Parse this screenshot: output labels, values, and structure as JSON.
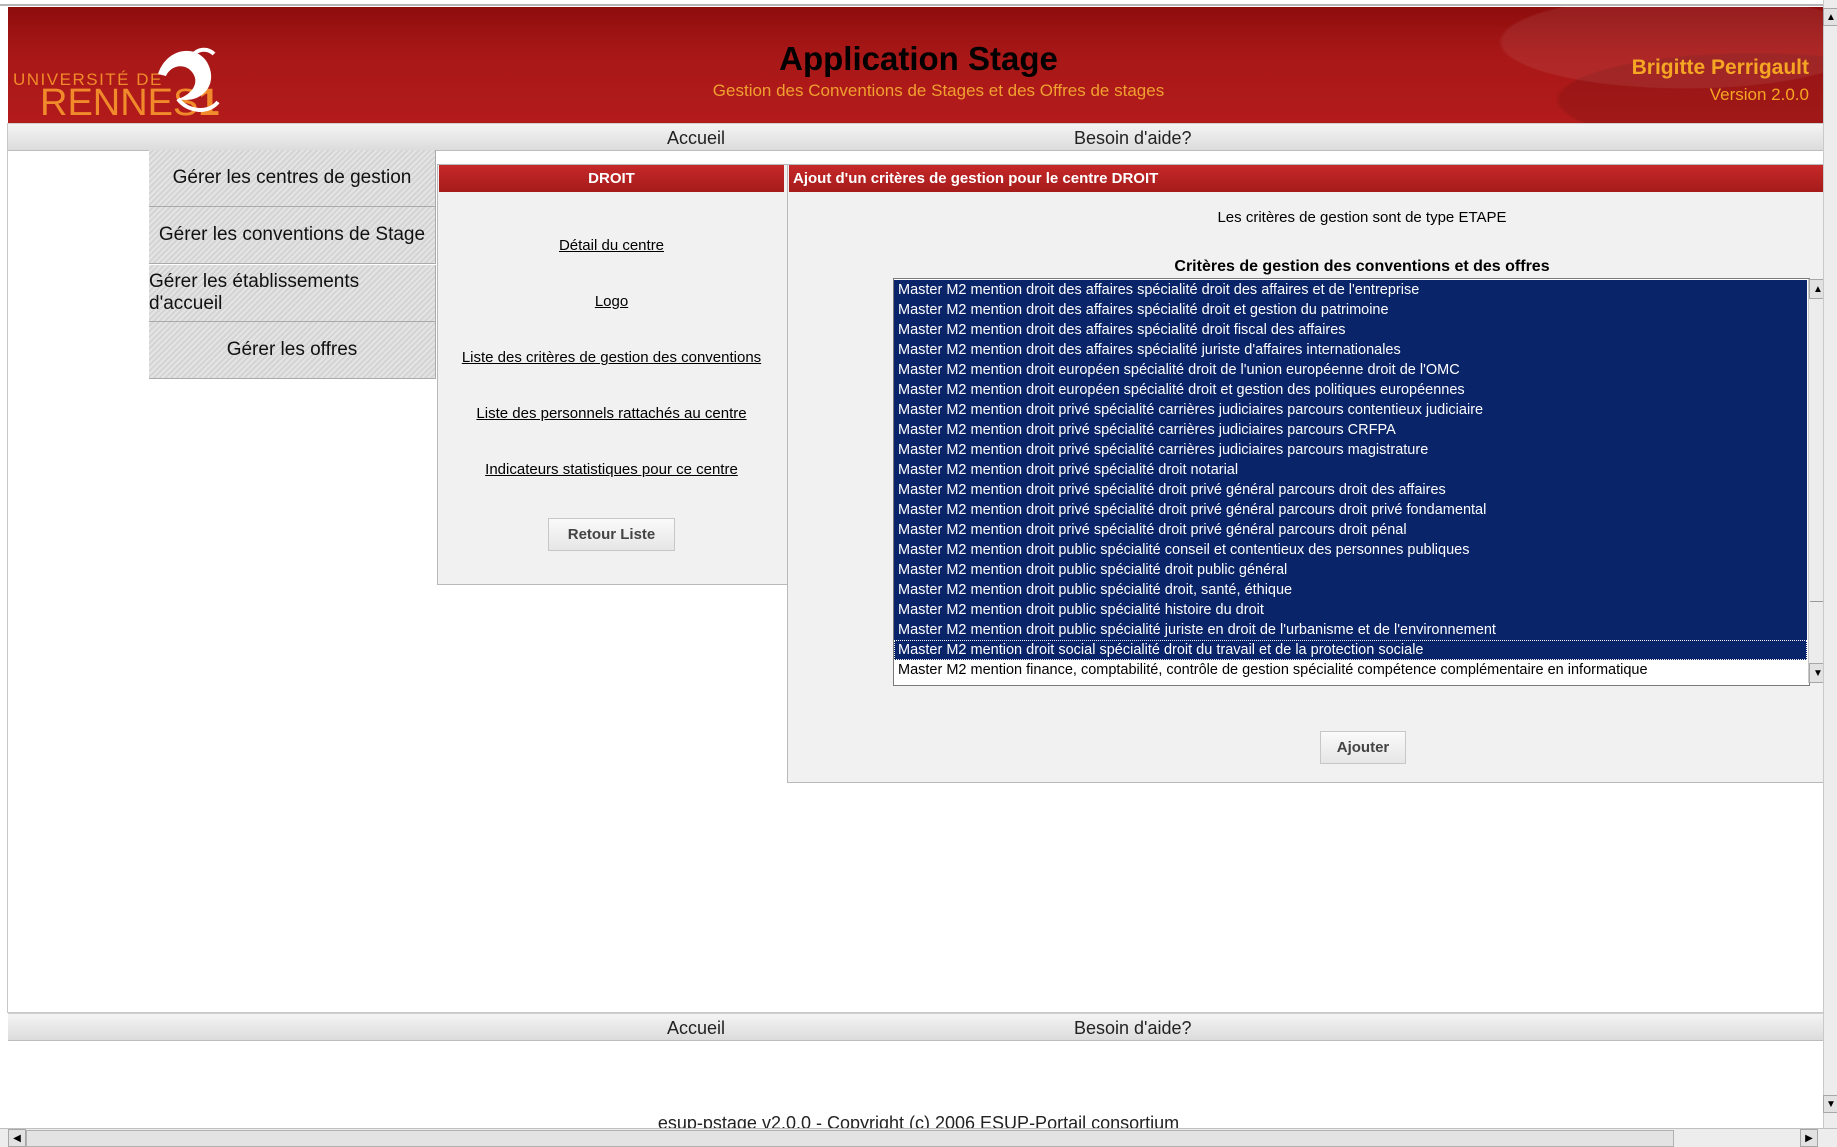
{
  "header": {
    "logo_top": "UNIVERSITÉ DE",
    "logo_main": "RENNES",
    "logo_number": "1",
    "title": "Application Stage",
    "subtitle": "Gestion des Conventions de Stages et des Offres de stages",
    "user_name": "Brigitte Perrigault",
    "version": "Version 2.0.0"
  },
  "nav_top": {
    "home": "Accueil",
    "help": "Besoin d'aide?"
  },
  "nav_bottom": {
    "home": "Accueil",
    "help": "Besoin d'aide?"
  },
  "menu": [
    {
      "label": "Gérer les centres de gestion"
    },
    {
      "label": "Gérer les conventions de Stage"
    },
    {
      "label": "Gérer les établissements d'accueil"
    },
    {
      "label": "Gérer les offres"
    }
  ],
  "center": {
    "title": "DROIT",
    "links": [
      "Détail du centre",
      "Logo",
      "Liste des critères de gestion des conventions",
      "Liste des personnels rattachés au centre",
      "Indicateurs statistiques pour ce centre"
    ],
    "back_button": "Retour Liste"
  },
  "right": {
    "title": "Ajout d'un critères de gestion pour le centre DROIT",
    "type_text": "Les critères de gestion sont de type ETAPE",
    "list_title": "Critères de gestion des conventions et des offres",
    "add_button": "Ajouter",
    "options": [
      {
        "label": "Master M2 mention droit des affaires spécialité droit des affaires et de l'entreprise",
        "selected": true
      },
      {
        "label": "Master M2 mention droit des affaires spécialité droit et gestion du patrimoine",
        "selected": true
      },
      {
        "label": "Master M2 mention droit des affaires spécialité droit fiscal des affaires",
        "selected": true
      },
      {
        "label": "Master M2 mention droit des affaires spécialité juriste d'affaires internationales",
        "selected": true
      },
      {
        "label": "Master M2 mention droit européen spécialité droit de l'union européenne droit de l'OMC",
        "selected": true
      },
      {
        "label": "Master M2 mention droit européen spécialité droit et gestion des politiques européennes",
        "selected": true
      },
      {
        "label": "Master M2 mention droit privé spécialité carrières judiciaires parcours contentieux judiciaire",
        "selected": true
      },
      {
        "label": "Master M2 mention droit privé spécialité carrières judiciaires parcours CRFPA",
        "selected": true
      },
      {
        "label": "Master M2 mention droit privé spécialité carrières judiciaires parcours magistrature",
        "selected": true
      },
      {
        "label": "Master M2 mention droit privé spécialité droit notarial",
        "selected": true
      },
      {
        "label": "Master M2 mention droit privé spécialité droit privé général parcours droit des affaires",
        "selected": true
      },
      {
        "label": "Master M2 mention droit privé spécialité droit privé général parcours droit privé fondamental",
        "selected": true
      },
      {
        "label": "Master M2 mention droit privé spécialité droit privé général parcours droit pénal",
        "selected": true
      },
      {
        "label": "Master M2 mention droit public spécialité conseil et contentieux des personnes publiques",
        "selected": true
      },
      {
        "label": "Master M2 mention droit public spécialité droit public général",
        "selected": true
      },
      {
        "label": "Master M2 mention droit public spécialité droit, santé, éthique",
        "selected": true
      },
      {
        "label": "Master M2 mention droit public spécialité histoire du droit",
        "selected": true
      },
      {
        "label": "Master M2 mention droit public spécialité juriste en droit de l'urbanisme et de l'environnement",
        "selected": true
      },
      {
        "label": "Master M2 mention droit social spécialité droit du travail et de la protection sociale",
        "selected": true,
        "focused": true
      },
      {
        "label": "Master M2 mention finance, comptabilité, contrôle de gestion spécialité compétence complémentaire en informatique",
        "selected": false
      }
    ]
  },
  "footer": {
    "copyright": "esup-pstage v2.0.0 - Copyright (c) 2006 ESUP-Portail consortium"
  },
  "colors": {
    "header_red": "#a81717",
    "accent_orange": "#f5a623",
    "selection_blue": "#0a246a"
  }
}
